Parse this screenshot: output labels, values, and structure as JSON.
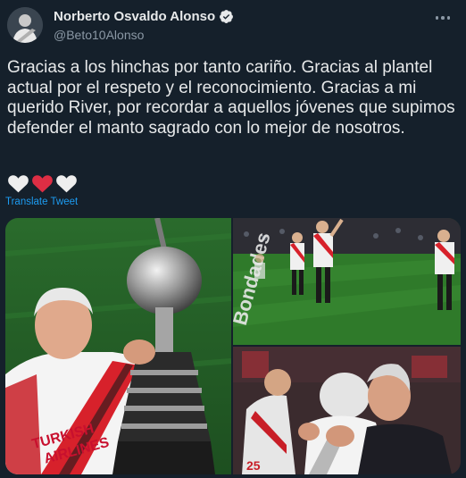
{
  "author": {
    "display_name": "Norberto Osvaldo Alonso",
    "handle": "@Beto10Alonso",
    "verified": true
  },
  "tweet": {
    "text": "Gracias a los hinchas por tanto cariño. Gracias al plantel actual por el respeto y el reconocimiento. Gracias a mi querido River, por recordar a aquellos jóvenes que supimos defender el manto sagrado con lo mejor de nosotros.",
    "emojis": [
      "white-heart",
      "red-heart",
      "white-heart"
    ],
    "translate_label": "Translate Tweet"
  },
  "media": {
    "jersey_text": "TURKISH\nAIRLINES",
    "field_text": "Bondades"
  },
  "colors": {
    "background": "#15202b",
    "link": "#1d9bf0",
    "verified": "#e7e9ea",
    "secondary_text": "#8b98a5"
  }
}
